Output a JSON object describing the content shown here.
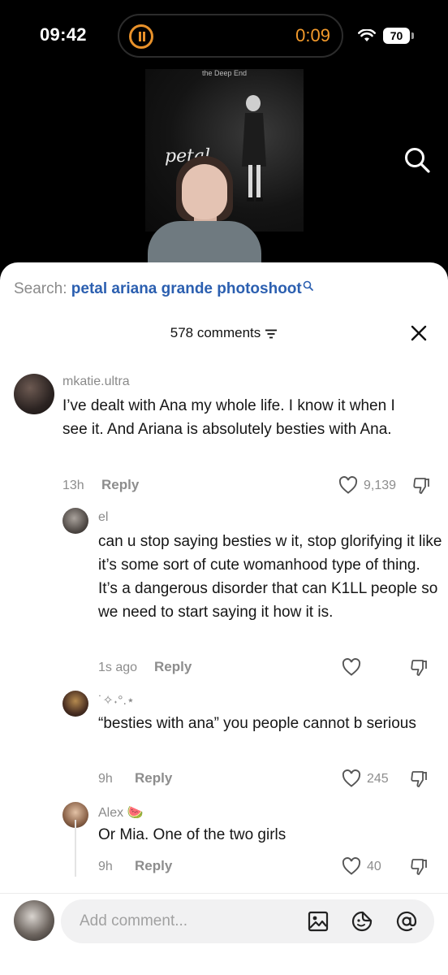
{
  "status_bar": {
    "time": "09:42",
    "timer": "0:09",
    "battery": "70",
    "accent_color": "#e8912a"
  },
  "video": {
    "poster_header": "the Deep End",
    "poster_title": "petal"
  },
  "sheet": {
    "search_prefix": "Search: ",
    "search_query": "petal ariana grande photoshoot",
    "comment_count": "578 comments",
    "input_placeholder": "Add comment...",
    "link_color": "#2b5fb0"
  },
  "comments": [
    {
      "username": "mkatie.ultra",
      "text": "I’ve dealt with Ana my whole life. I know it when I see it. And Ariana is absolutely besties with Ana.",
      "time": "13h",
      "reply_label": "Reply",
      "likes": "9,139"
    },
    {
      "username": "el",
      "text": "can u stop saying besties w it, stop glorifying it like it’s some sort of cute womanhood type of thing. It’s a dangerous disorder that can K1LL people so we need to start saying it how it is.",
      "time": "1s ago",
      "reply_label": "Reply",
      "likes": ""
    },
    {
      "username": "˙✧˖°.⋆",
      "text": "“besties with ana” you people cannot b serious",
      "time": "9h",
      "reply_label": "Reply",
      "likes": "245"
    },
    {
      "username": "Alex 🍉",
      "text": "Or Mia. One of the two girls",
      "time": "9h",
      "reply_label": "Reply",
      "likes": "40"
    }
  ]
}
